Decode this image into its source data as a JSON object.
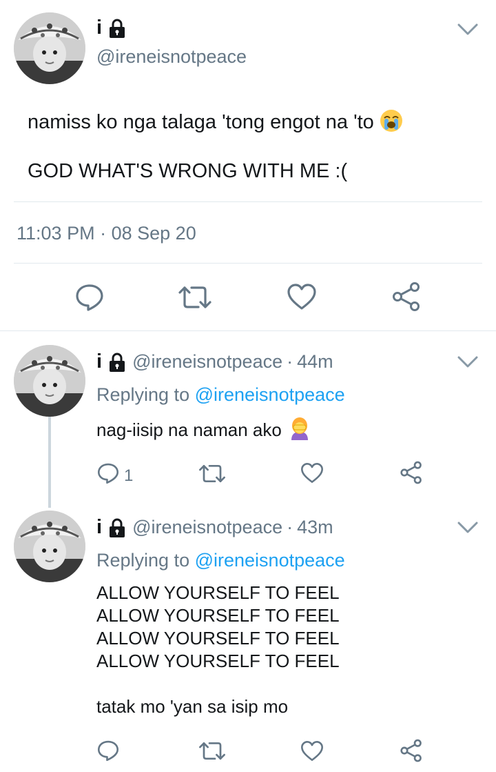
{
  "main_tweet": {
    "name": "i",
    "handle": "@ireneisnotpeace",
    "text_line1": "namiss ko nga talaga 'tong engot na 'to",
    "text_line2": "GOD WHAT'S WRONG WITH ME :(",
    "time": "11:03 PM",
    "date_sep": "·",
    "date": "08 Sep 20",
    "icons": {
      "lock": "lock-icon",
      "emoji": "loudly-crying-face-emoji",
      "reply": "reply-icon",
      "retweet": "retweet-icon",
      "like": "heart-icon",
      "share": "share-icon"
    }
  },
  "replies": [
    {
      "name": "i",
      "handle": "@ireneisnotpeace",
      "sep": "·",
      "age": "44m",
      "replying_prefix": "Replying to",
      "replying_mention": "@ireneisnotpeace",
      "text": "nag-iisip na naman ako",
      "emoji": "woman-facepalming-emoji",
      "reply_count": "1"
    },
    {
      "name": "i",
      "handle": "@ireneisnotpeace",
      "sep": "·",
      "age": "43m",
      "replying_prefix": "Replying to",
      "replying_mention": "@ireneisnotpeace",
      "lines": [
        "ALLOW YOURSELF TO FEEL",
        "ALLOW YOURSELF TO FEEL",
        "ALLOW YOURSELF TO FEEL",
        "ALLOW YOURSELF TO FEEL"
      ],
      "closing": "tatak mo 'yan sa isip mo"
    }
  ],
  "colors": {
    "text": "#14171a",
    "secondary": "#657786",
    "link": "#1da1f2",
    "divider": "#e1e8ed",
    "icon": "#657786"
  }
}
